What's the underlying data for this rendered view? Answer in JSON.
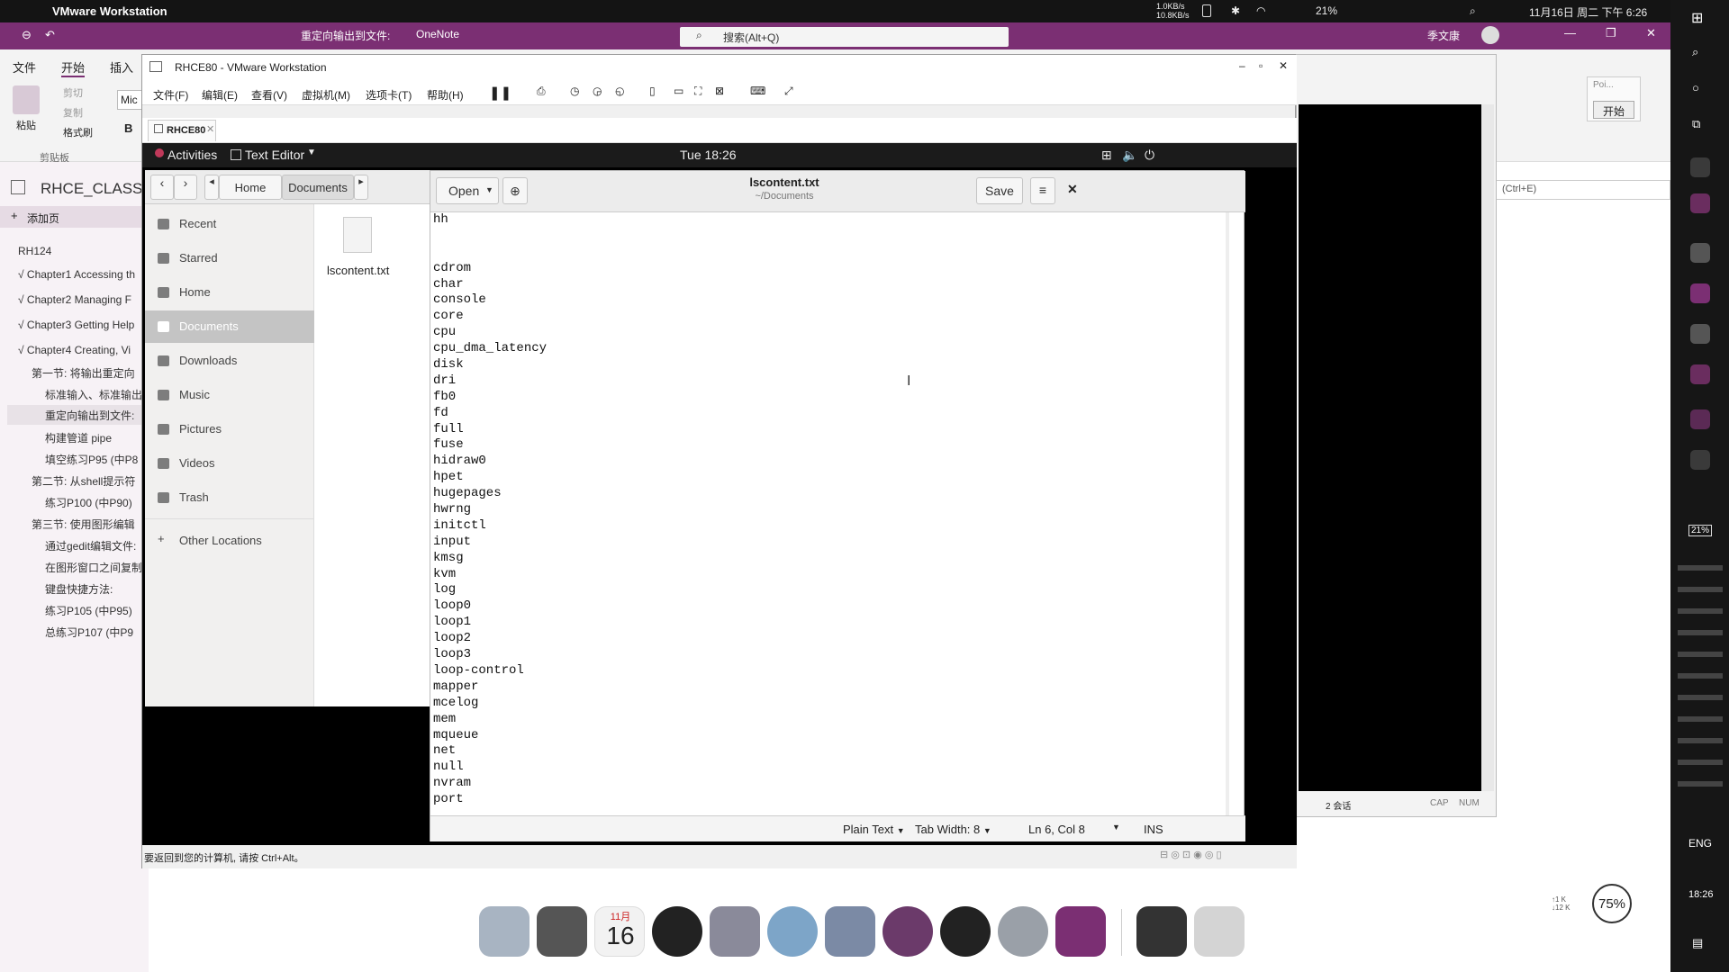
{
  "macbar": {
    "app_name": "VMware Workstation",
    "net_up": "1.0KB/s",
    "net_down": "10.8KB/s",
    "battery": "21%",
    "datetime": "11月16日 周二 下午 6:26"
  },
  "onenote": {
    "doc_title": "重定向输出到文件:",
    "app": "OneNote",
    "search_placeholder": "搜索(Alt+Q)",
    "user": "季文康",
    "ribbon_tabs": [
      "文件",
      "开始",
      "插入"
    ],
    "clipboard": {
      "paste": "粘贴",
      "cut": "剪切",
      "copy": "复制",
      "format_painter": "格式刷",
      "group": "剪贴板"
    },
    "font_box": "Mic",
    "bold": "B",
    "notebook_title": "RHCE_CLASS",
    "add_page": "添加页",
    "pages": [
      "RH124",
      "√ Chapter1 Accessing th",
      "√ Chapter2 Managing F",
      "√ Chapter3 Getting Help",
      "√ Chapter4 Creating, Vi",
      "第一节: 将输出重定向",
      "标准输入、标准输出",
      "重定向输出到文件:",
      "构建管道 pipe",
      "填空练习P95 (中P8",
      "第二节: 从shell提示符",
      "练习P100 (中P90)",
      "第三节: 使用图形编辑",
      "通过gedit编辑文件:",
      "在图形窗口之间复制",
      "键盘快捷方法:",
      "练习P105 (中P95)",
      "总练习P107 (中P9"
    ],
    "right_panel": {
      "search_hint": "(Ctrl+E)",
      "start_btn": "开始",
      "ppt_hint": "Poi..."
    }
  },
  "vmware": {
    "title": "RHCE80 - VMware Workstation",
    "menu": [
      "文件(F)",
      "编辑(E)",
      "查看(V)",
      "虚拟机(M)",
      "选项卡(T)",
      "帮助(H)"
    ],
    "tab": "RHCE80",
    "status_hint": "要返回到您的计算机, 请按 Ctrl+Alt。"
  },
  "gnome": {
    "activities": "Activities",
    "app_menu": "Text Editor",
    "clock": "Tue 18:26"
  },
  "files": {
    "breadcrumb_home": "Home",
    "breadcrumb_current": "Documents",
    "sidebar": [
      "Recent",
      "Starred",
      "Home",
      "Documents",
      "Downloads",
      "Music",
      "Pictures",
      "Videos",
      "Trash",
      "Other Locations"
    ],
    "file_name": "lscontent.txt"
  },
  "gedit": {
    "open_label": "Open",
    "filename": "lscontent.txt",
    "path": "~/Documents",
    "save_label": "Save",
    "lines": [
      "hh",
      "",
      "",
      "cdrom",
      "char",
      "console",
      "core",
      "cpu",
      "cpu_dma_latency",
      "disk",
      "dri",
      "fb0",
      "fd",
      "full",
      "fuse",
      "hidraw0",
      "hpet",
      "hugepages",
      "hwrng",
      "initctl",
      "input",
      "kmsg",
      "kvm",
      "log",
      "loop0",
      "loop1",
      "loop2",
      "loop3",
      "loop-control",
      "mapper",
      "mcelog",
      "mem",
      "mqueue",
      "net",
      "null",
      "nvram",
      "port"
    ],
    "status": {
      "syntax": "Plain Text",
      "tab_width": "Tab Width: 8",
      "position": "Ln 6, Col 8",
      "mode": "INS"
    }
  },
  "terminal_window": {
    "sessions": "2 会话",
    "cap": "CAP",
    "num": "NUM"
  },
  "system": {
    "battery_side": "21%",
    "lang": "ENG",
    "time_side": "18:26",
    "zoom": "75%"
  },
  "dock": {
    "calendar_month": "11月",
    "calendar_day": "16"
  }
}
